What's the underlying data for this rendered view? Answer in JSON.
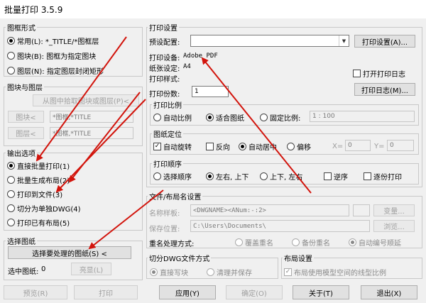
{
  "window": {
    "title": "批量打印 3.5.9"
  },
  "frame_form": {
    "title": "图框形式",
    "options": [
      {
        "label": "常用(L): *_TITLE/*图框层",
        "checked": true
      },
      {
        "label": "图块(B): 图框为指定图块",
        "checked": false
      },
      {
        "label": "图层(N): 指定图层封闭矩形",
        "checked": false
      }
    ]
  },
  "block_layer": {
    "title": "图块与图层",
    "pick_button": "从图中拾取图块或图层(P)<",
    "block_button": "图块<",
    "block_value": "*图框,*TITLE",
    "layer_button": "图层<",
    "layer_value": "*图框,*TITLE"
  },
  "output": {
    "title": "输出选项",
    "options": [
      {
        "label": "直接批量打印(1)",
        "checked": true
      },
      {
        "label": "批量生成布局(2)",
        "checked": false
      },
      {
        "label": "打印到文件(3)",
        "checked": false
      },
      {
        "label": "切分为单独DWG(4)",
        "checked": false
      },
      {
        "label": "打印已有布局(5)",
        "checked": false
      }
    ]
  },
  "select": {
    "title": "选择图纸",
    "button": "选择要处理的图纸(S) <",
    "selected_label": "选中图纸:",
    "selected_count": "0",
    "highlight_button": "亮显(L)"
  },
  "print_settings": {
    "title": "打印设置",
    "preset_label": "预设配置:",
    "preset_value": "",
    "settings_button": "打印设置(A)...",
    "device_label": "打印设备:",
    "device_value": "Adobe PDF",
    "paper_label": "纸张设定:",
    "paper_value": "A4",
    "style_label": "打印样式:",
    "style_value": "",
    "copies_label": "打印份数:",
    "copies_value": "1",
    "log_checkbox": "打开打印日志",
    "log_button": "打印日志(M)..."
  },
  "scale": {
    "title": "打印比例",
    "options": [
      {
        "label": "自动比例",
        "checked": false
      },
      {
        "label": "适合图纸",
        "checked": true
      },
      {
        "label": "固定比例:",
        "checked": false
      }
    ],
    "fixed_value": "1 : 100"
  },
  "position": {
    "title": "图纸定位",
    "auto_rotate": "自动旋转",
    "reverse": "反向",
    "auto_center": "自动居中",
    "offset": "偏移",
    "x_label": "X=",
    "x_value": "0",
    "y_label": "Y=",
    "y_value": "0"
  },
  "order": {
    "title": "打印顺序",
    "options": [
      {
        "label": "选择顺序",
        "checked": false
      },
      {
        "label": "左右, 上下",
        "checked": true
      },
      {
        "label": "上下, 左右",
        "checked": false
      }
    ],
    "reverse": "逆序",
    "by_copy": "逐份打印"
  },
  "file_naming": {
    "title": "文件/布局名设置",
    "name_label": "名称样板:",
    "name_value": "<DWGNAME><ANum:-:2>",
    "name_button": "变量...",
    "path_label": "保存位置:",
    "path_value": "C:\\Users\\Documents\\",
    "path_button": "浏览...",
    "dup_label": "重名处理方式:",
    "dup_options": [
      {
        "label": "覆盖重名",
        "checked": false
      },
      {
        "label": "备份重名",
        "checked": false
      },
      {
        "label": "自动编号顺延",
        "checked": true
      }
    ]
  },
  "split": {
    "title": "切分DWG文件方式",
    "options": [
      {
        "label": "直接写块",
        "checked": true
      },
      {
        "label": "清理并保存",
        "checked": false
      }
    ]
  },
  "layout": {
    "title": "布局设置",
    "checkbox": "布局使用模型空间的线型比例"
  },
  "bottom": {
    "preview": "预览(R)",
    "print": "打印",
    "apply": "应用(Y)",
    "ok": "确定(O)",
    "about": "关于(T)",
    "exit": "退出(X)"
  },
  "colors": {
    "arrow": "#d2140c",
    "window_bg": "#f0f0f0"
  }
}
